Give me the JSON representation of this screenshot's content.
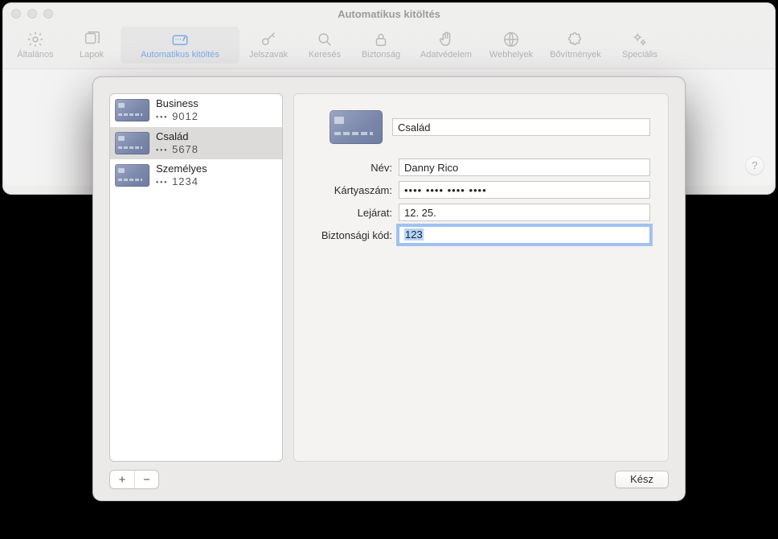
{
  "window": {
    "title": "Automatikus kitöltés",
    "help_tooltip": "?"
  },
  "toolbar": [
    {
      "label": "Általános",
      "icon": "gear"
    },
    {
      "label": "Lapok",
      "icon": "tabs"
    },
    {
      "label": "Automatikus kitöltés",
      "icon": "autofill",
      "selected": true
    },
    {
      "label": "Jelszavak",
      "icon": "key"
    },
    {
      "label": "Keresés",
      "icon": "search"
    },
    {
      "label": "Biztonság",
      "icon": "lock"
    },
    {
      "label": "Adatvédelem",
      "icon": "hand"
    },
    {
      "label": "Webhelyek",
      "icon": "globe"
    },
    {
      "label": "Bővítmények",
      "icon": "puzzle"
    },
    {
      "label": "Speciális",
      "icon": "gears"
    }
  ],
  "cards": [
    {
      "title": "Business",
      "last4": "9012"
    },
    {
      "title": "Család",
      "last4": "5678",
      "selected": true
    },
    {
      "title": "Személyes",
      "last4": "1234"
    }
  ],
  "mask_dots": "•••",
  "detail": {
    "description_value": "Család",
    "name_label": "Név:",
    "name_value": "Danny Rico",
    "number_label": "Kártyaszám:",
    "number_masked": "•••• •••• •••• ••••",
    "expiry_label": "Lejárat:",
    "expiry_value": "12. 25.",
    "cvc_label": "Biztonsági kód:",
    "cvc_value": "123"
  },
  "footer": {
    "add": "+",
    "remove": "−",
    "done": "Kész"
  }
}
